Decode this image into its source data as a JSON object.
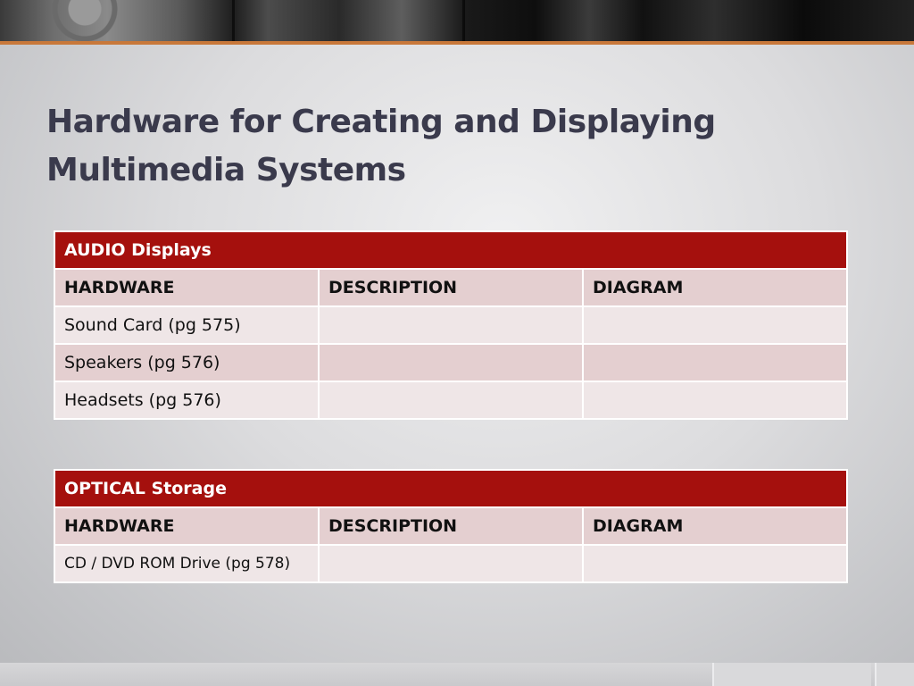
{
  "slide": {
    "title_lines": [
      "Hardware for Creating and Displaying",
      "Multimedia Systems"
    ]
  },
  "tables": [
    {
      "heading": "AUDIO Displays",
      "columns": [
        "HARDWARE",
        "DESCRIPTION",
        "DIAGRAM"
      ],
      "rows": [
        [
          "Sound Card (pg 575)",
          "",
          ""
        ],
        [
          "Speakers (pg 576)",
          "",
          ""
        ],
        [
          "Headsets (pg 576)",
          "",
          ""
        ]
      ]
    },
    {
      "heading": "OPTICAL Storage",
      "columns": [
        "HARDWARE",
        "DESCRIPTION",
        "DIAGRAM"
      ],
      "rows": [
        [
          "CD / DVD ROM Drive (pg 578)",
          "",
          ""
        ]
      ]
    }
  ],
  "colors": {
    "table_header": "#a5100d",
    "row_dark": "#e4cfd0",
    "row_light": "#efe6e7",
    "title_text": "#3a3a4c",
    "accent_line": "#c8783a"
  }
}
